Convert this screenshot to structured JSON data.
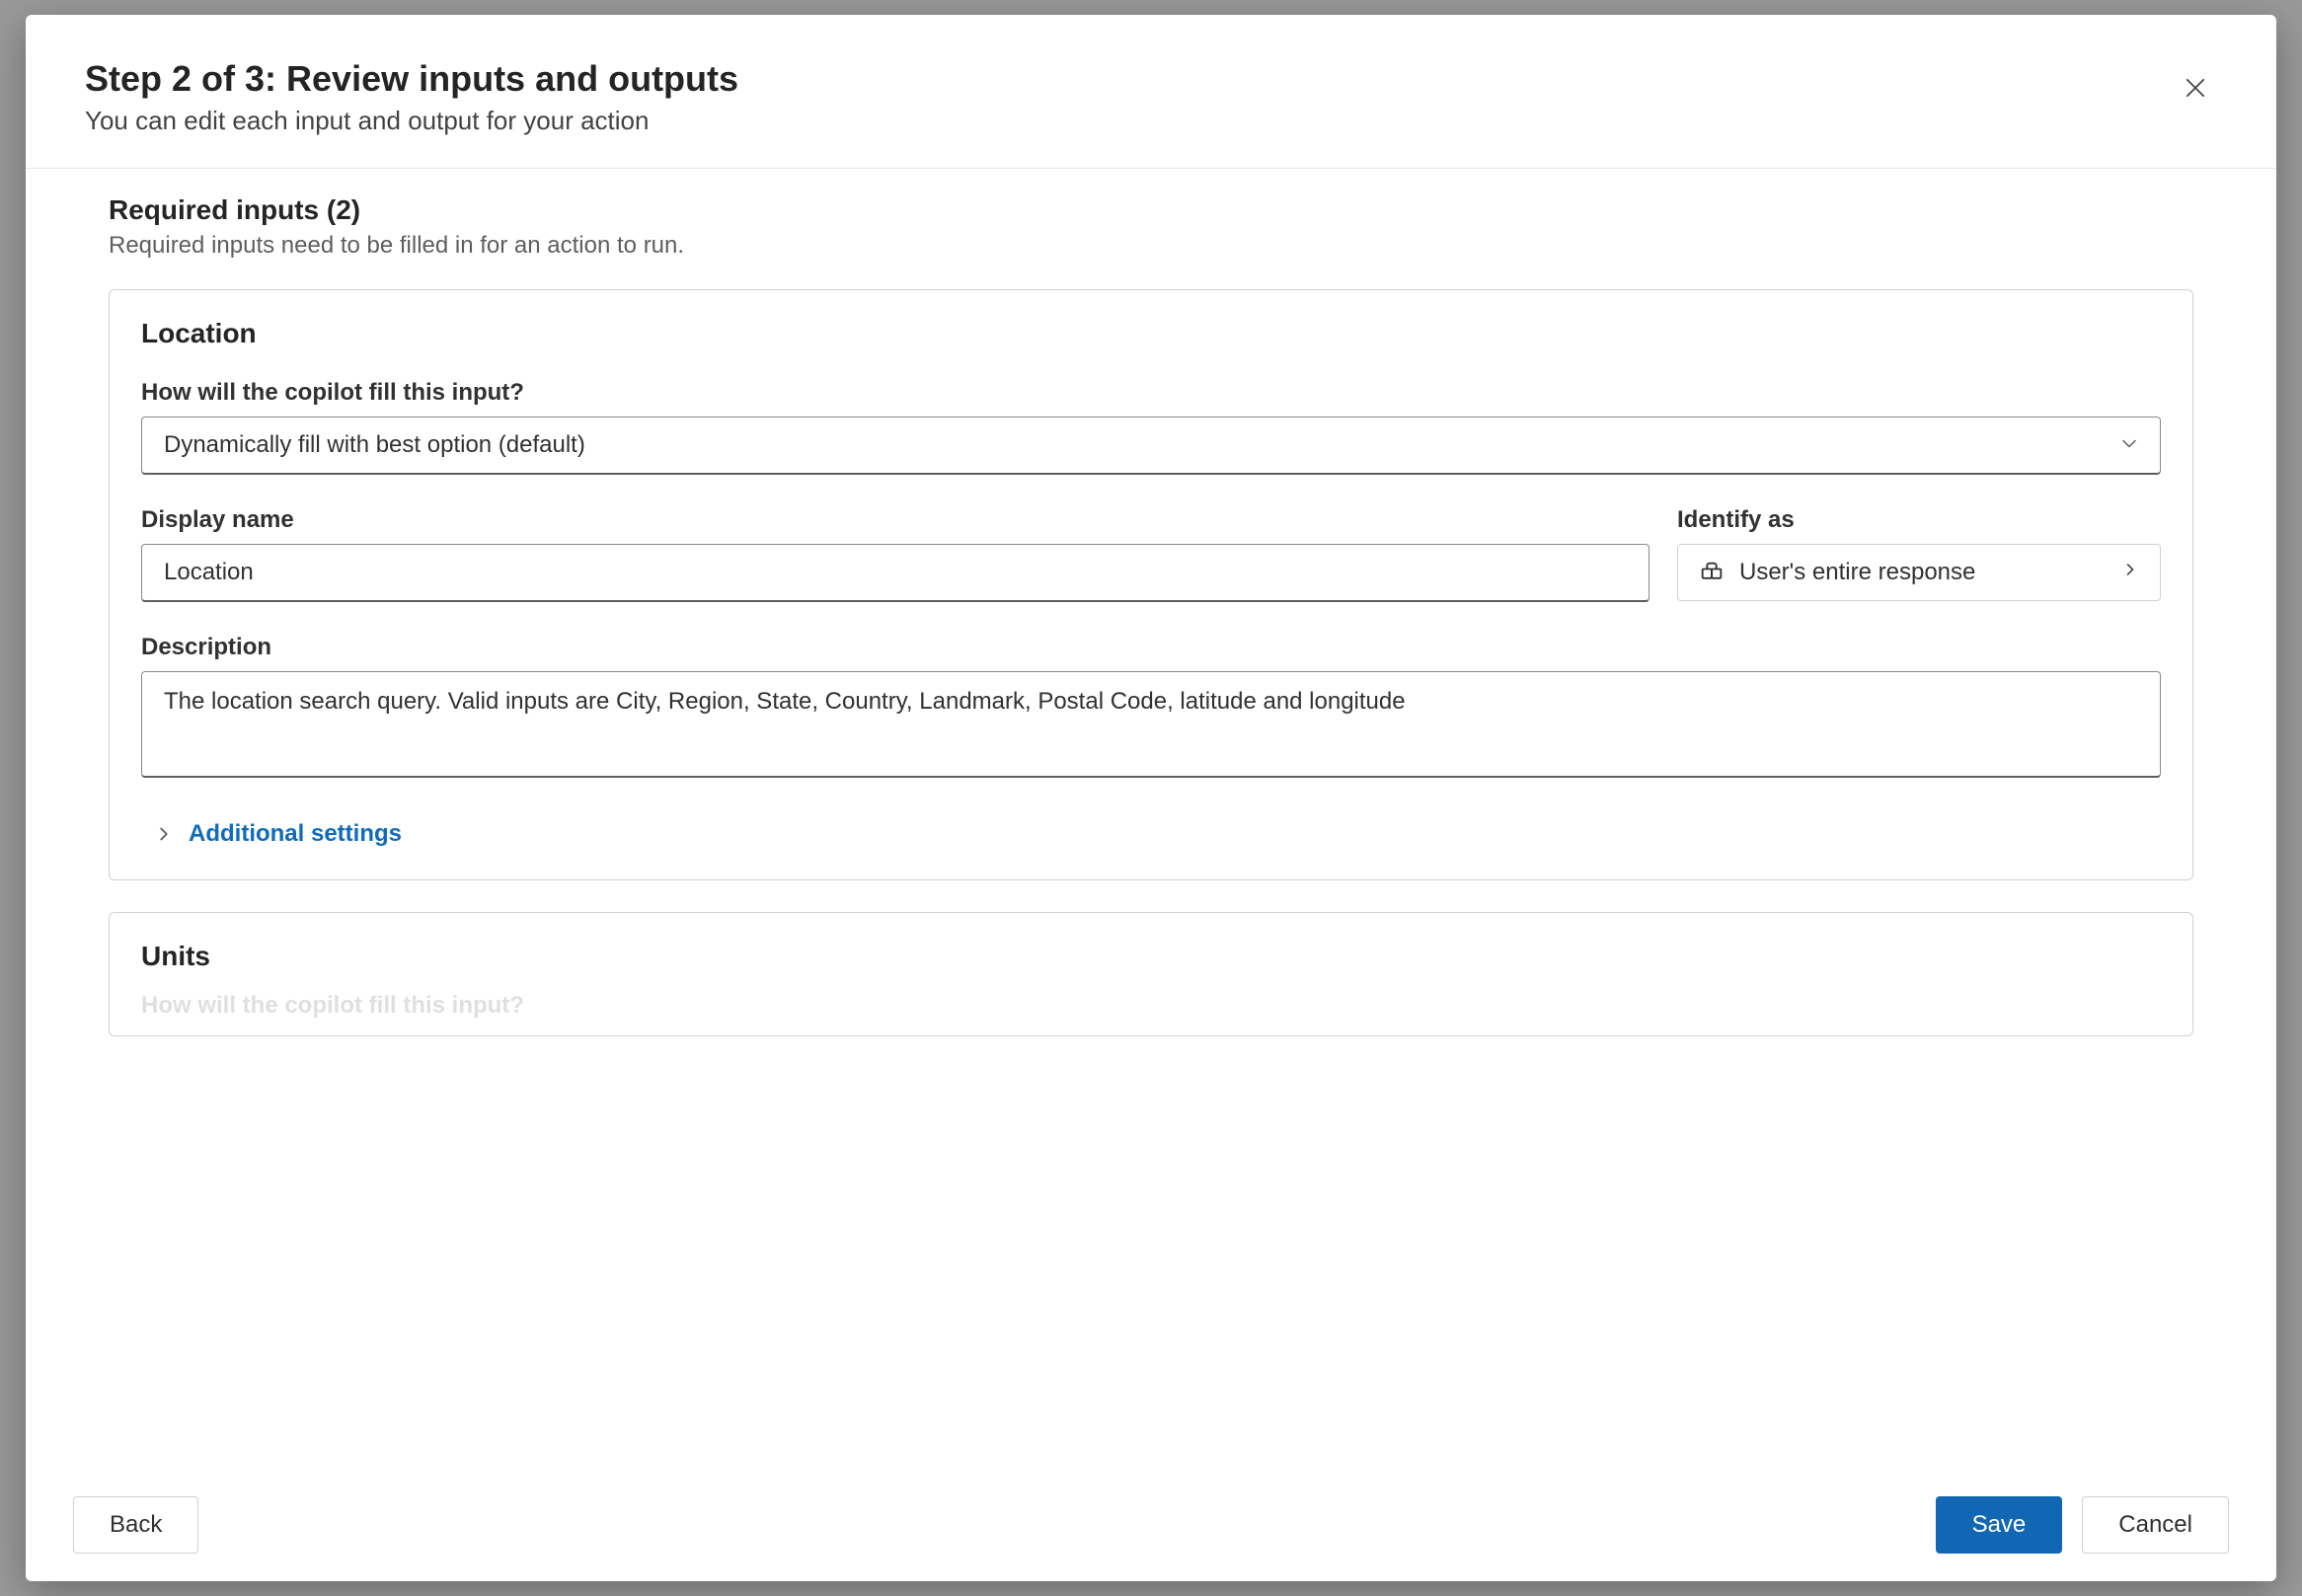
{
  "header": {
    "title": "Step 2 of 3: Review inputs and outputs",
    "subtitle": "You can edit each input and output for your action"
  },
  "section": {
    "title": "Required inputs (2)",
    "subtitle": "Required inputs need to be filled in for an action to run."
  },
  "cards": [
    {
      "title": "Location",
      "fill_label": "How will the copilot fill this input?",
      "fill_value": "Dynamically fill with best option (default)",
      "display_name_label": "Display name",
      "display_name_value": "Location",
      "identify_label": "Identify as",
      "identify_value": "User's entire response",
      "description_label": "Description",
      "description_value": "The location search query. Valid inputs are City, Region, State, Country, Landmark, Postal Code, latitude and longitude",
      "additional_settings_label": "Additional settings"
    },
    {
      "title": "Units",
      "fill_label": "How will the copilot fill this input?"
    }
  ],
  "footer": {
    "back": "Back",
    "save": "Save",
    "cancel": "Cancel"
  }
}
